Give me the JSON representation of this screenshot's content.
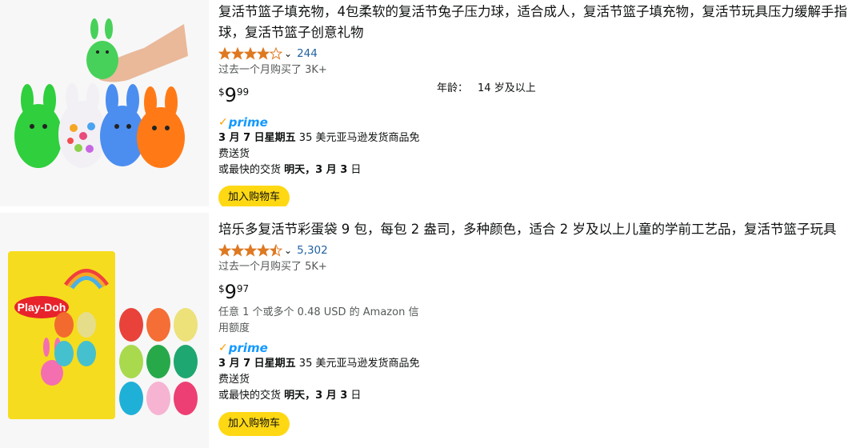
{
  "products": [
    {
      "title": "复活节篮子填充物，4包柔软的复活节兔子压力球，适合成人，复活节篮子填充物，复活节玩具压力缓解手指球，复活节篮子创意礼物",
      "rating_value": 4.0,
      "rating_icon": "star-icon",
      "rating_count": "244",
      "bought_text": "过去一个月购买了 3K+",
      "price_symbol": "$",
      "price_whole": "9",
      "price_fraction": "99",
      "age_label": "年龄：",
      "age_value": "14 岁及以上",
      "prime_check": "✓",
      "prime_label": "prime",
      "delivery_date": "3 月 7 日星期五",
      "delivery_text": " 35 美元亚马逊发货商品免费送货",
      "fastest_prefix": "或最快的交货 ",
      "fastest_date": "明天，3 月 3",
      "fastest_suffix": " 日",
      "cart_label": "加入购物车"
    },
    {
      "title": "培乐多复活节彩蛋袋 9 包，每包 2 盎司，多种颜色，适合 2 岁及以上儿童的学前工艺品，复活节篮子玩具",
      "rating_value": 4.5,
      "rating_icon": "star-icon",
      "rating_count": "5,302",
      "bought_text": "过去一个月购买了 5K+",
      "price_symbol": "$",
      "price_whole": "9",
      "price_fraction": "97",
      "credit_text": "任意 1 个或多个 0.48 USD 的 Amazon 信用额度",
      "prime_check": "✓",
      "prime_label": "prime",
      "delivery_date": "3 月 7 日星期五",
      "delivery_text": " 35 美元亚马逊发货商品免费送货",
      "fastest_prefix": "或最快的交货 ",
      "fastest_date": "明天，3 月 3",
      "fastest_suffix": " 日",
      "cart_label": "加入购物车",
      "image_brand_text": "Play-Doh"
    }
  ],
  "colors": {
    "star": "#de7921",
    "link": "#2162a1",
    "prime": "#1399ff",
    "prime_check": "#fe9e00",
    "button": "#ffd814"
  }
}
